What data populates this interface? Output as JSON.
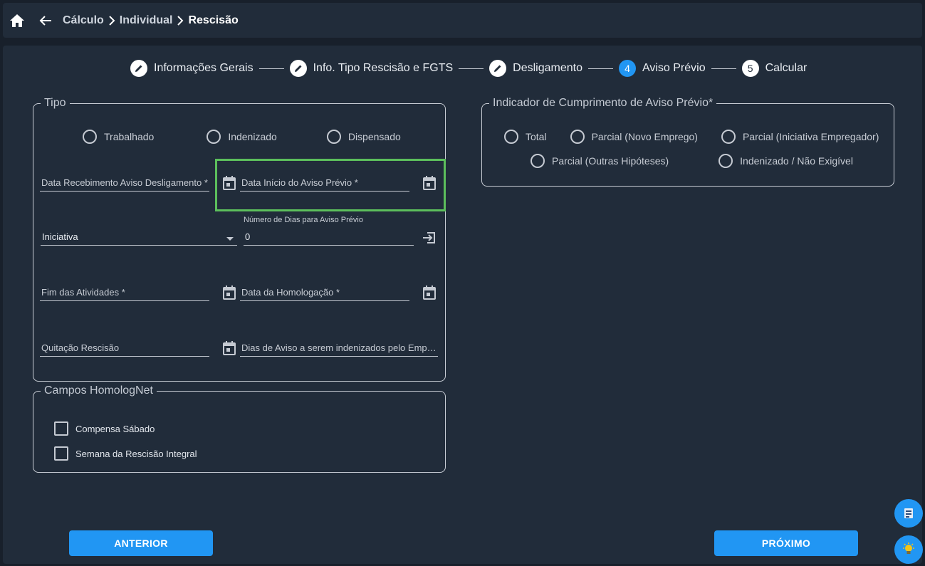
{
  "breadcrumb": {
    "items": [
      "Cálculo",
      "Individual",
      "Rescisão"
    ]
  },
  "stepper": {
    "steps": [
      {
        "label": "Informações Gerais",
        "marker": "pencil-icon"
      },
      {
        "label": "Info. Tipo Rescisão e FGTS",
        "marker": "pencil-icon"
      },
      {
        "label": "Desligamento",
        "marker": "pencil-icon"
      },
      {
        "label": "Aviso Prévio",
        "number": "4"
      },
      {
        "label": "Calcular",
        "number": "5"
      }
    ]
  },
  "tipo": {
    "legend": "Tipo",
    "options": [
      "Trabalhado",
      "Indenizado",
      "Dispensado"
    ],
    "fields": {
      "data_recebimento": "Data Recebimento Aviso Desligamento *",
      "data_inicio": "Data Início do Aviso Prévio *",
      "iniciativa": "Iniciativa",
      "numero_dias_label": "Número de Dias para Aviso Prévio",
      "numero_dias_value": "0",
      "fim_atividades": "Fim das Atividades *",
      "data_homologacao": "Data da Homologação *",
      "quitacao": "Quitação Rescisão",
      "dias_aviso": "Dias de Aviso a serem indenizados pelo Empregado"
    }
  },
  "homolognet": {
    "legend": "Campos HomologNet",
    "checkboxes": [
      "Compensa Sábado",
      "Semana da Rescisão Integral"
    ]
  },
  "indicador": {
    "legend": "Indicador de Cumprimento de Aviso Prévio*",
    "row1": [
      "Total",
      "Parcial (Novo Emprego)",
      "Parcial (Iniciativa Empregador)"
    ],
    "row2": [
      "Parcial (Outras Hipóteses)",
      "Indenizado / Não Exigível"
    ]
  },
  "buttons": {
    "anterior": "ANTERIOR",
    "proximo": "PRÓXIMO"
  },
  "colors": {
    "accent": "#2196f3",
    "highlight": "#5cbf5c",
    "panel": "#212c3a"
  }
}
